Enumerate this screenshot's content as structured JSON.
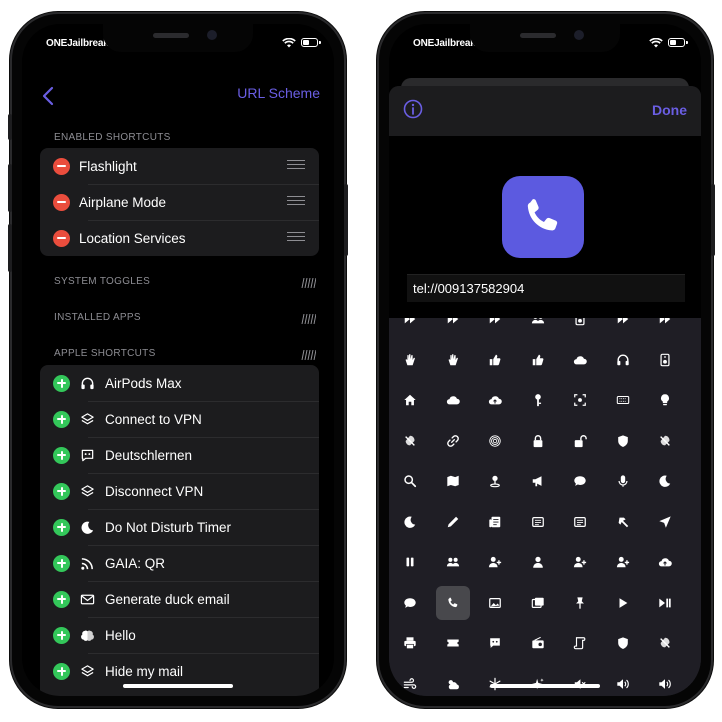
{
  "left": {
    "status": {
      "carrier": "ONEJailbreak"
    },
    "nav": {
      "title": "URL Scheme"
    },
    "sections": {
      "enabled": "ENABLED SHORTCUTS",
      "system": "SYSTEM TOGGLES",
      "installed": "INSTALLED APPS",
      "apple": "APPLE SHORTCUTS"
    },
    "enabled_items": [
      "Flashlight",
      "Airplane Mode",
      "Location Services"
    ],
    "apple_items": [
      {
        "label": "AirPods Max",
        "icon": "headphones-icon"
      },
      {
        "label": "Connect to VPN",
        "icon": "layers-icon"
      },
      {
        "label": "Deutschlernen",
        "icon": "quote-bubble-icon"
      },
      {
        "label": "Disconnect VPN",
        "icon": "layers-icon"
      },
      {
        "label": "Do Not Disturb Timer",
        "icon": "moon-icon"
      },
      {
        "label": "GAIA: QR",
        "icon": "rss-icon"
      },
      {
        "label": "Generate duck email",
        "icon": "envelope-icon"
      },
      {
        "label": "Hello",
        "icon": "brain-icon"
      },
      {
        "label": "Hide my mail",
        "icon": "layers-icon"
      }
    ]
  },
  "right": {
    "status": {
      "carrier": "ONEJailbreak"
    },
    "done_label": "Done",
    "url_value": "tel://009137582904",
    "selected_icon": "phone-icon",
    "colors": {
      "accent": "#6a5ee3",
      "tile": "#5c5ae0",
      "remove": "#ea4d3d",
      "add": "#33c75a"
    }
  }
}
